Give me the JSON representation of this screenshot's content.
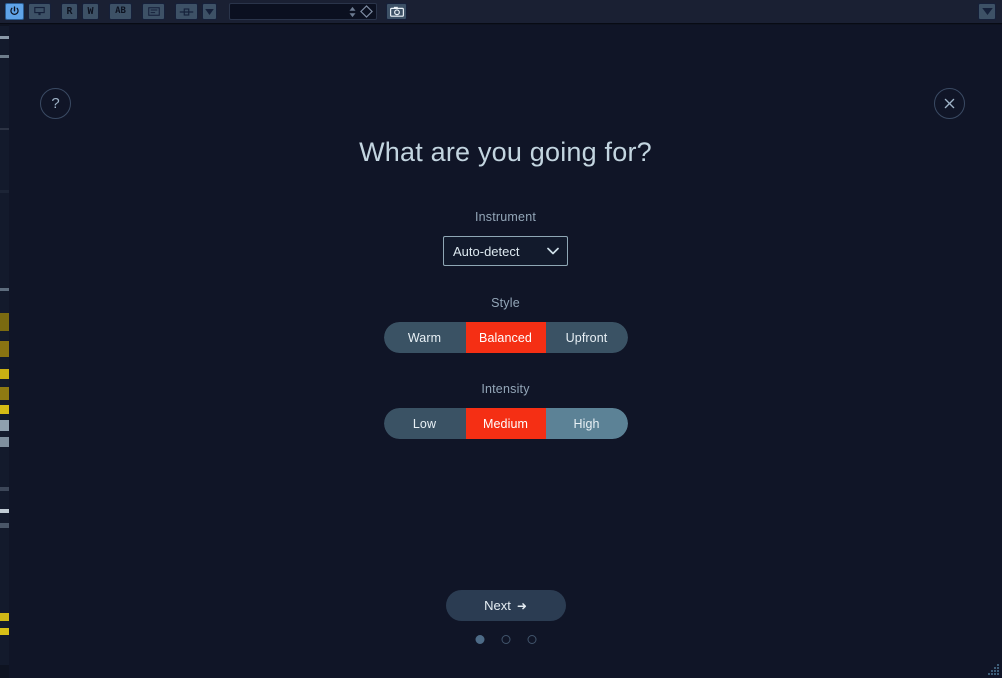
{
  "window": {
    "background_color": "#0e1321",
    "overlay_color": "#101527"
  },
  "toolbar": {
    "buttons": [
      {
        "name": "power-icon",
        "label": "power",
        "icon": "power",
        "active": true
      },
      {
        "name": "monitor-icon",
        "label": "monitor",
        "icon": "monitor",
        "active": false
      },
      {
        "name": "read-automation",
        "label": "R",
        "icon": "text-R",
        "active": false
      },
      {
        "name": "write-automation",
        "label": "W",
        "icon": "text-W",
        "active": false
      },
      {
        "name": "ab-compare-icon",
        "label": "AB",
        "icon": "text-AB",
        "active": false
      },
      {
        "name": "preset-list-icon",
        "label": "list",
        "icon": "list",
        "active": false
      },
      {
        "name": "routing-icon",
        "label": "routing",
        "icon": "routing",
        "active": false
      },
      {
        "name": "routing-dropdown",
        "label": "▼",
        "icon": "caret",
        "active": false
      }
    ],
    "preset_field_value": "",
    "spinner_icon": "up-down-arrows-icon",
    "diamond_icon": "diamond-icon",
    "camera_icon": "camera-icon",
    "right_menu_icon": "caret-down-icon"
  },
  "dialog": {
    "help_button": {
      "label": "?",
      "icon": "question-mark-icon"
    },
    "close_button": {
      "label": "",
      "icon": "close-x-icon"
    },
    "title": "What are you going for?",
    "fields": [
      {
        "id": "instrument",
        "label": "Instrument",
        "type": "select",
        "value": "Auto-detect",
        "options": [
          "Auto-detect"
        ]
      },
      {
        "id": "style",
        "label": "Style",
        "type": "segmented",
        "value": "Balanced",
        "options": [
          {
            "label": "Warm",
            "state": "normal",
            "width": 82
          },
          {
            "label": "Balanced",
            "state": "selected",
            "width": 80
          },
          {
            "label": "Upfront",
            "state": "normal",
            "width": 82
          }
        ]
      },
      {
        "id": "intensity",
        "label": "Intensity",
        "type": "segmented",
        "value": "Medium",
        "options": [
          {
            "label": "Low",
            "state": "normal",
            "width": 82
          },
          {
            "label": "Medium",
            "state": "selected",
            "width": 80
          },
          {
            "label": "High",
            "state": "hovered",
            "width": 82
          }
        ]
      }
    ],
    "next_button": {
      "label": "Next",
      "arrow": "➜"
    },
    "pagination": {
      "total": 3,
      "current": 1
    }
  },
  "colors": {
    "accent_selected": "#f52f14",
    "segment_default": "#3a5264",
    "segment_hover": "#5c8296",
    "next_button": "#2b3c52",
    "label_text": "#93a6b8",
    "title_text": "#c3d5e0",
    "toolbar_button": "#3d5166",
    "toolbar_active": "#5fa3e8"
  },
  "track_strips": [
    {
      "color": "#131a2c",
      "height": 10
    },
    {
      "color": "#8a99a8",
      "height": 3
    },
    {
      "color": "#131a2c",
      "height": 16
    },
    {
      "color": "#6e7d8c",
      "height": 3
    },
    {
      "color": "#131a2c",
      "height": 70
    },
    {
      "color": "#2c3344",
      "height": 2
    },
    {
      "color": "#131a2c",
      "height": 60
    },
    {
      "color": "#1c2436",
      "height": 3
    },
    {
      "color": "#131a2c",
      "height": 95
    },
    {
      "color": "#5d6c7d",
      "height": 3
    },
    {
      "color": "#131a2c",
      "height": 22
    },
    {
      "color": "#7a6a10",
      "height": 18
    },
    {
      "color": "#131a2c",
      "height": 10
    },
    {
      "color": "#8a7412",
      "height": 16
    },
    {
      "color": "#131a2c",
      "height": 12
    },
    {
      "color": "#c9b013",
      "height": 10
    },
    {
      "color": "#131a2c",
      "height": 8
    },
    {
      "color": "#8e7a12",
      "height": 13
    },
    {
      "color": "#131a2c",
      "height": 5
    },
    {
      "color": "#d4bb15",
      "height": 9
    },
    {
      "color": "#131a2c",
      "height": 6
    },
    {
      "color": "#8fa0ae",
      "height": 11
    },
    {
      "color": "#131a2c",
      "height": 6
    },
    {
      "color": "#7f8f9e",
      "height": 10
    },
    {
      "color": "#131a2c",
      "height": 40
    },
    {
      "color": "#3c4658",
      "height": 4
    },
    {
      "color": "#131a2c",
      "height": 18
    },
    {
      "color": "#c0cbd4",
      "height": 4
    },
    {
      "color": "#131a2c",
      "height": 10
    },
    {
      "color": "#4a5668",
      "height": 5
    },
    {
      "color": "#131a2c",
      "height": 85
    },
    {
      "color": "#cfb716",
      "height": 8
    },
    {
      "color": "#131a2c",
      "height": 7
    },
    {
      "color": "#d8c017",
      "height": 7
    },
    {
      "color": "#131a2c",
      "height": 30
    }
  ]
}
